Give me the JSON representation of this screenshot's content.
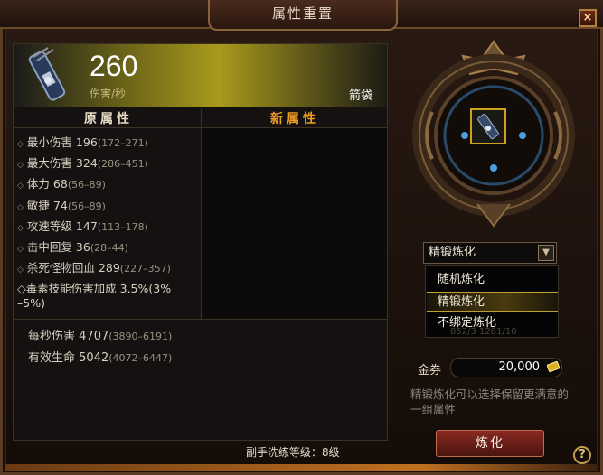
{
  "window": {
    "title": "属性重置",
    "close_label": "×"
  },
  "item": {
    "dps": "260",
    "dps_label": "伤害/秒",
    "type": "箭袋"
  },
  "columns": {
    "old": "原属性",
    "new": "新属性"
  },
  "stats": [
    {
      "name": "最小伤害",
      "value": "196",
      "range": "(172–271)"
    },
    {
      "name": "最大伤害",
      "value": "324",
      "range": "(286–451)"
    },
    {
      "name": "体力",
      "value": "68",
      "range": "(56–89)"
    },
    {
      "name": "敏捷",
      "value": "74",
      "range": "(56–89)"
    },
    {
      "name": "攻速等级",
      "value": "147",
      "range": "(113–178)"
    },
    {
      "name": "击中回复",
      "value": "36",
      "range": "(28–44)"
    },
    {
      "name": "杀死怪物回血",
      "value": "289",
      "range": "(227–357)"
    },
    {
      "name": "毒素技能伤害加成",
      "value": "3.5%",
      "range": "(3%",
      "range2": "–5%)"
    }
  ],
  "summary": [
    {
      "name": "每秒伤害",
      "value": "4707",
      "range": "(3890–6191)"
    },
    {
      "name": "有效生命",
      "value": "5042",
      "range": "(4072–6447)"
    }
  ],
  "refine_level": "副手洗练等级：8级",
  "select": {
    "current": "精锻炼化",
    "options": [
      "随机炼化",
      "精锻炼化",
      "不绑定炼化"
    ],
    "selected_index": 1,
    "hidden_text": "852/3    1281/10"
  },
  "gold": {
    "label": "金券",
    "value": "20,000"
  },
  "description": "精锻炼化可以选择保留更满意的一组属性",
  "refine_button": "炼化",
  "help_label": "?",
  "colors": {
    "new_header": "#f0a020",
    "button": "#8a2a22",
    "accent_gold": "#c0a030"
  }
}
